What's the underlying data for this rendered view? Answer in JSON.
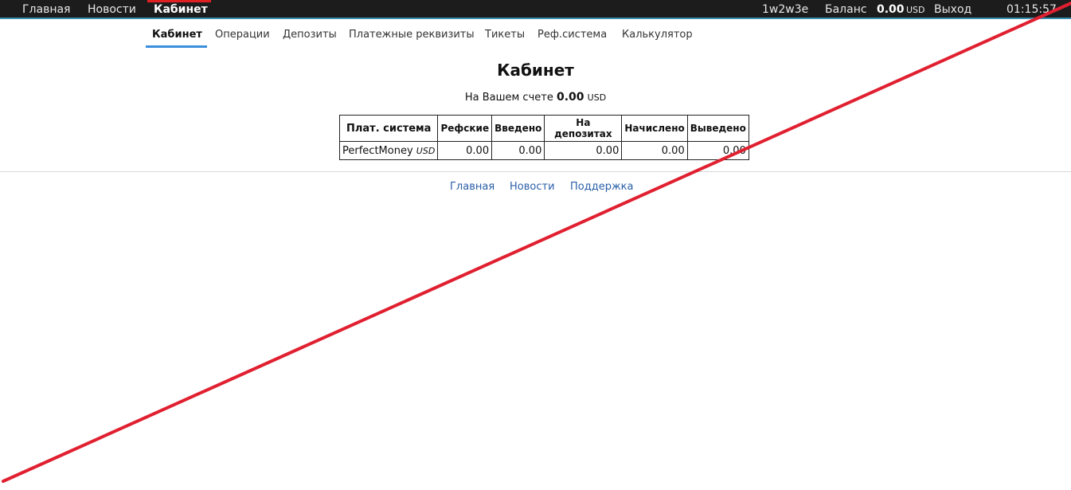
{
  "topbar": {
    "home": "Главная",
    "news": "Новости",
    "cabinet": "Кабинет",
    "user": "1w2w3e",
    "balance_label": "Баланс",
    "balance_value": "0.00",
    "balance_currency": "USD",
    "exit": "Выход",
    "time": "01:15:57"
  },
  "subnav": {
    "items": [
      "Кабинет",
      "Операции",
      "Депозиты",
      "Платежные реквизиты",
      "Тикеты",
      "Реф.система",
      "Калькулятор"
    ],
    "active": "Кабинет"
  },
  "main": {
    "title": "Кабинет",
    "balance_prefix": "На Вашем счете",
    "balance_value": "0.00",
    "balance_currency": "USD"
  },
  "table": {
    "headers": [
      "Плат. система",
      "Рефские",
      "Введено",
      "На депозитах",
      "Начислено",
      "Выведено"
    ],
    "rows": [
      {
        "system": "PerfectMoney",
        "currency": "USD",
        "values": [
          "0.00",
          "0.00",
          "0.00",
          "0.00",
          "0.00"
        ]
      }
    ]
  },
  "footer": {
    "links": [
      "Главная",
      "Новости",
      "Поддержка"
    ]
  },
  "colors": {
    "topbar_bg": "#1c1c1c",
    "accent_red": "#e02020",
    "accent_blue": "#3a8fdc",
    "link_blue": "#2a5fa8"
  }
}
